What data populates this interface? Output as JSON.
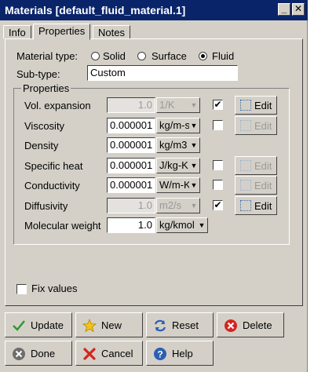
{
  "window": {
    "title": "Materials [default_fluid_material.1]"
  },
  "tabs": [
    {
      "label": "Info"
    },
    {
      "label": "Properties"
    },
    {
      "label": "Notes"
    }
  ],
  "material_type": {
    "label": "Material type:",
    "options": [
      "Solid",
      "Surface",
      "Fluid"
    ],
    "selected": "Fluid"
  },
  "subtype": {
    "label": "Sub-type:",
    "value": "Custom"
  },
  "properties": {
    "group_label": "Properties",
    "edit_label": "Edit",
    "rows": [
      {
        "name": "Vol. expansion",
        "value": "1.0",
        "unit": "1/K",
        "disabled": true,
        "checkbox": "checked",
        "edit": "enabled"
      },
      {
        "name": "Viscosity",
        "value": "0.000001",
        "unit": "kg/m-s",
        "disabled": false,
        "checkbox": "unchecked",
        "edit": "disabled"
      },
      {
        "name": "Density",
        "value": "0.000001",
        "unit": "kg/m3",
        "disabled": false,
        "checkbox": "none",
        "edit": "none"
      },
      {
        "name": "Specific heat",
        "value": "0.000001",
        "unit": "J/kg-K",
        "disabled": false,
        "checkbox": "unchecked",
        "edit": "disabled"
      },
      {
        "name": "Conductivity",
        "value": "0.000001",
        "unit": "W/m-K",
        "disabled": false,
        "checkbox": "unchecked",
        "edit": "disabled"
      },
      {
        "name": "Diffusivity",
        "value": "1.0",
        "unit": "m2/s",
        "disabled": true,
        "checkbox": "checked",
        "edit": "enabled"
      },
      {
        "name": "Molecular weight",
        "value": "1.0",
        "unit": "kg/kmol",
        "disabled": false,
        "checkbox": "none",
        "edit": "none"
      }
    ]
  },
  "fix_values": {
    "label": "Fix values",
    "checked": false
  },
  "buttons": {
    "update": "Update",
    "new": "New",
    "reset": "Reset",
    "delete": "Delete",
    "done": "Done",
    "cancel": "Cancel",
    "help": "Help"
  },
  "colors": {
    "titlebar": "#0a246a",
    "face": "#d4d0c8",
    "disabled_text": "#9a9a9a"
  }
}
